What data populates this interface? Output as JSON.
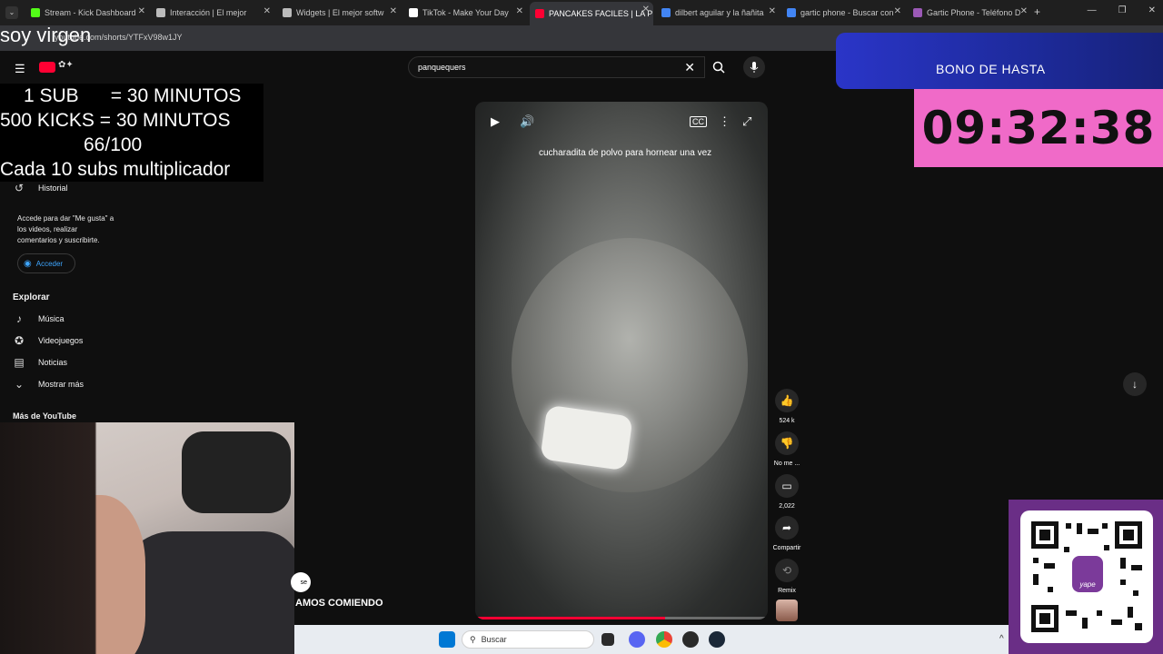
{
  "browser": {
    "tabs": [
      {
        "label": "Stream - Kick Dashboard",
        "color": "#53fc18"
      },
      {
        "label": "Interacción | El mejor",
        "color": "#bbbbbb"
      },
      {
        "label": "Widgets | El mejor softw",
        "color": "#bbbbbb"
      },
      {
        "label": "TikTok - Make Your Day",
        "color": "#ffffff"
      },
      {
        "label": "PANCAKES FACILES | LA P",
        "color": "#ff0033"
      },
      {
        "label": "dilbert aguilar y la ñañita",
        "color": "#4285f4"
      },
      {
        "label": "gartic phone - Buscar con",
        "color": "#4285f4"
      },
      {
        "label": "Gartic Phone - Teléfono D",
        "color": "#9b59b6"
      }
    ],
    "url": "youtube.com/shorts/YTFxV98w1JY"
  },
  "overlay": {
    "soy": "soy virgen",
    "rules": [
      "1 SUB      = 30 MINUTOS",
      "500 KICKS = 30 MINUTOS",
      "66/100",
      "Cada 10 subs multiplicador"
    ],
    "bono_label": "BONO DE HASTA",
    "timer": "09:32:38",
    "bottom_text": "AMOS COMIENDO",
    "pill_text": "se"
  },
  "sidebar": {
    "historial": "Historial",
    "signin_text": "Accede para dar \"Me gusta\" a los videos, realizar comentarios y suscribirte.",
    "signin_button": "Acceder",
    "explore_heading": "Explorar",
    "explore_items": [
      "Música",
      "Videojuegos",
      "Noticias",
      "Mostrar más"
    ],
    "more_heading": "Más de YouTube"
  },
  "search": {
    "value": "panquequers"
  },
  "video": {
    "caption": "cucharadita de polvo para hornear una vez",
    "progress_percent": 65
  },
  "actions": {
    "like_count": "524 k",
    "dislike_label": "No me ...",
    "comments_count": "2,022",
    "share_label": "Compartir",
    "remix_label": "Remix"
  },
  "taskbar": {
    "search_placeholder": "Buscar"
  }
}
